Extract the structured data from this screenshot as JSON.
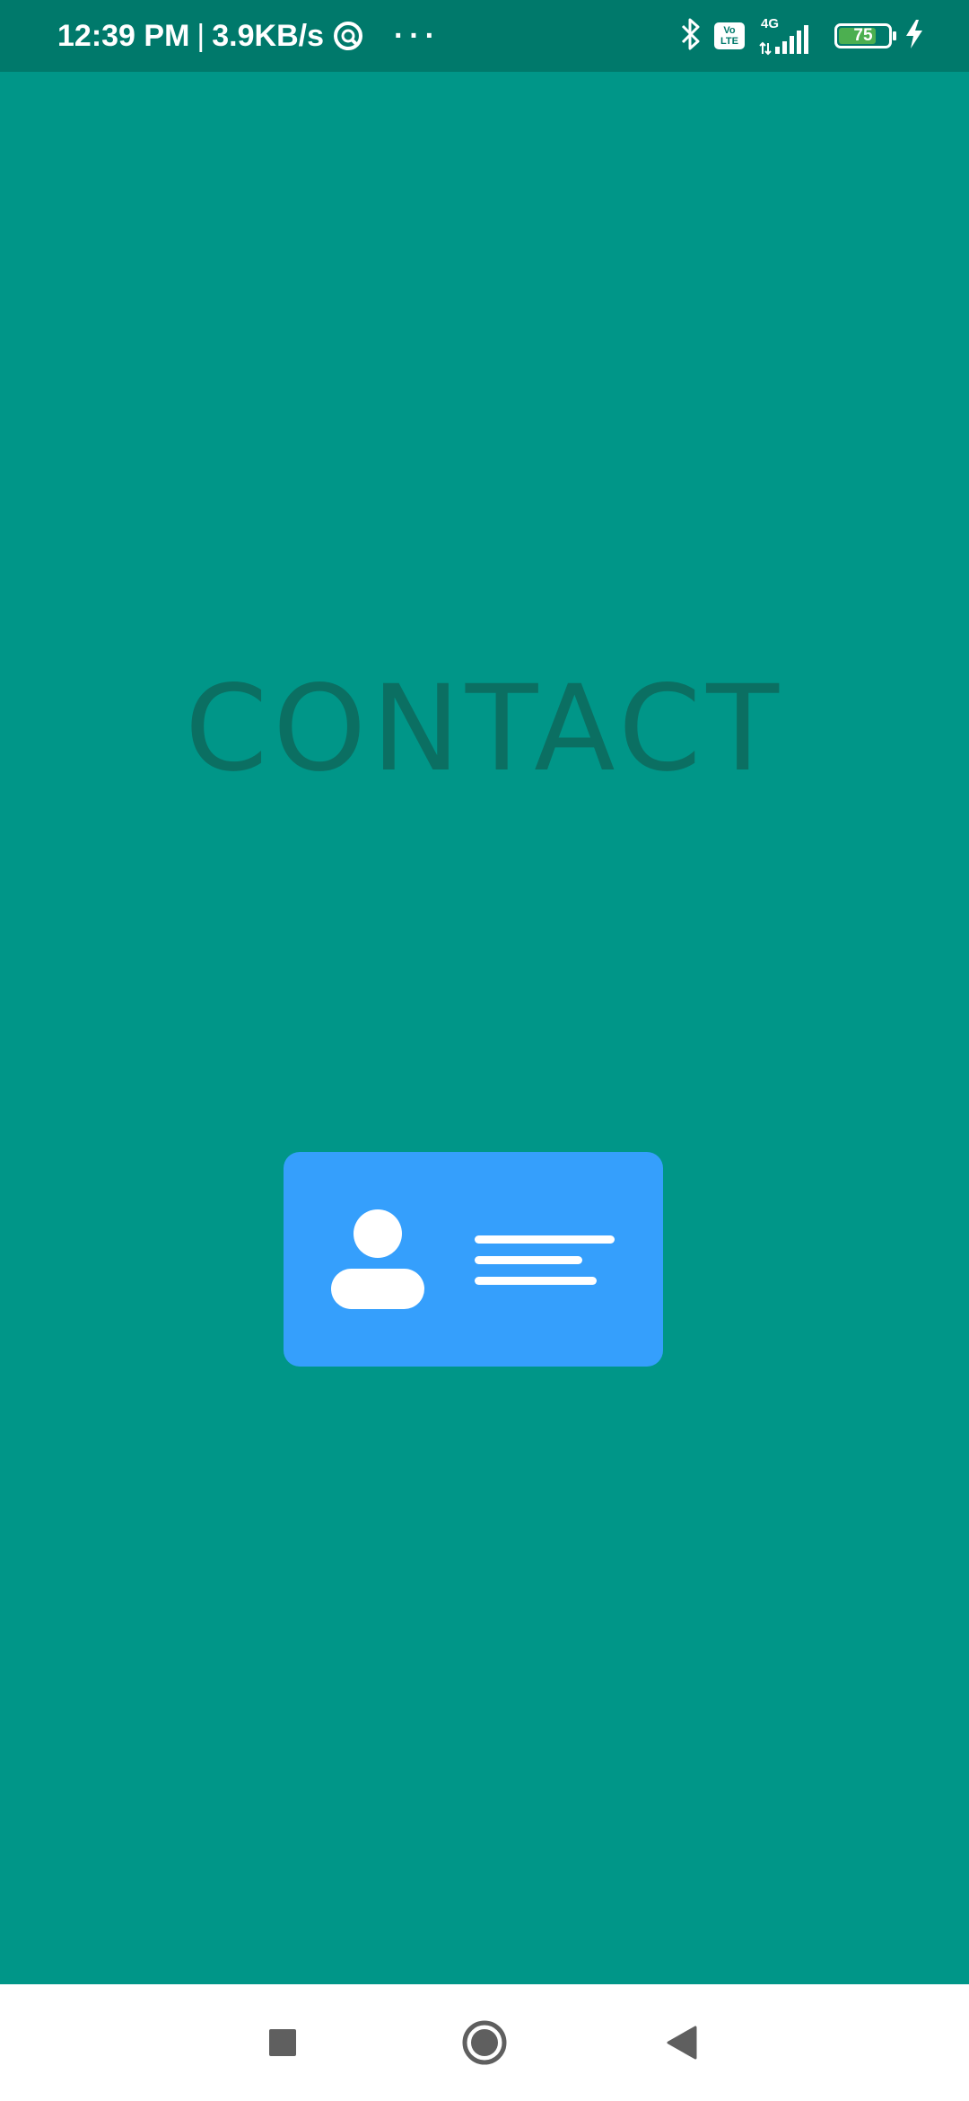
{
  "status_bar": {
    "time": "12:39 PM",
    "separator": "|",
    "network_speed": "3.9KB/s",
    "more_indicator": "···",
    "volte_top": "Vo",
    "volte_bottom": "LTE",
    "network_type": "4G",
    "battery_level": "75",
    "battery_fraction": 0.75,
    "icons": [
      "sync-icon",
      "bluetooth-icon",
      "volte-icon",
      "signal-icon",
      "battery-icon",
      "charging-icon"
    ]
  },
  "main": {
    "title": "CONTACT",
    "illustration": "contact-card-icon"
  },
  "nav_bar": {
    "buttons": [
      "recents-button",
      "home-button",
      "back-button"
    ]
  },
  "colors": {
    "background": "#009688",
    "status_bar": "#00796b",
    "title_text": "#0b6f62",
    "card": "#359ffc",
    "nav_bar": "#ffffff",
    "nav_icon": "#5f5f5f",
    "battery_fill": "#4caf50"
  }
}
